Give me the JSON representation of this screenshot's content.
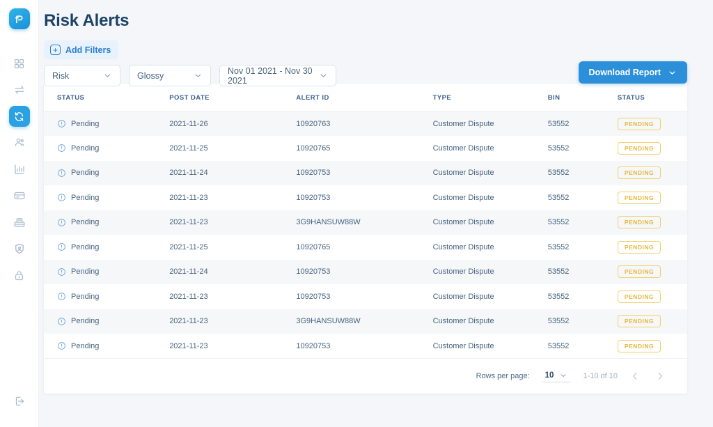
{
  "app": {
    "logo_name": "pagos-logo",
    "accent_blue": "#2b8fd9",
    "title_color": "#1c4266",
    "badge_color": "#e8b73c"
  },
  "sidebar": {
    "items": [
      {
        "icon": "grid-dashboard-icon",
        "active": false
      },
      {
        "icon": "transfer-arrows-icon",
        "active": false
      },
      {
        "icon": "refresh-sync-icon",
        "active": true
      },
      {
        "icon": "users-icon",
        "active": false
      },
      {
        "icon": "bar-chart-icon",
        "active": false
      },
      {
        "icon": "credit-card-icon",
        "active": false
      },
      {
        "icon": "cash-register-icon",
        "active": false
      },
      {
        "icon": "shield-user-icon",
        "active": false
      },
      {
        "icon": "lock-icon",
        "active": false
      }
    ],
    "logout": {
      "icon": "logout-icon"
    }
  },
  "header": {
    "title": "Risk Alerts"
  },
  "filters": {
    "add_filters_label": "Add Filters",
    "risk": {
      "value": "Risk"
    },
    "merchant": {
      "value": "Glossy"
    },
    "date_range": {
      "value": "Nov 01 2021 - Nov 30 2021"
    },
    "download_label": "Download Report"
  },
  "table": {
    "columns": [
      "STATUS",
      "POST DATE",
      "ALERT ID",
      "TYPE",
      "BIN",
      "STATUS"
    ],
    "rows": [
      {
        "status": "Pending",
        "post_date": "2021-11-26",
        "alert_id": "10920763",
        "type": "Customer Dispute",
        "bin": "53552",
        "badge": "PENDING"
      },
      {
        "status": "Pending",
        "post_date": "2021-11-25",
        "alert_id": "10920765",
        "type": "Customer Dispute",
        "bin": "53552",
        "badge": "PENDING"
      },
      {
        "status": "Pending",
        "post_date": "2021-11-24",
        "alert_id": "10920753",
        "type": "Customer Dispute",
        "bin": "53552",
        "badge": "PENDING"
      },
      {
        "status": "Pending",
        "post_date": "2021-11-23",
        "alert_id": "10920753",
        "type": "Customer Dispute",
        "bin": "53552",
        "badge": "PENDING"
      },
      {
        "status": "Pending",
        "post_date": "2021-11-23",
        "alert_id": "3G9HANSUW88W",
        "type": "Customer Dispute",
        "bin": "53552",
        "badge": "PENDING"
      },
      {
        "status": "Pending",
        "post_date": "2021-11-25",
        "alert_id": "10920765",
        "type": "Customer Dispute",
        "bin": "53552",
        "badge": "PENDING"
      },
      {
        "status": "Pending",
        "post_date": "2021-11-24",
        "alert_id": "10920753",
        "type": "Customer Dispute",
        "bin": "53552",
        "badge": "PENDING"
      },
      {
        "status": "Pending",
        "post_date": "2021-11-23",
        "alert_id": "10920753",
        "type": "Customer Dispute",
        "bin": "53552",
        "badge": "PENDING"
      },
      {
        "status": "Pending",
        "post_date": "2021-11-23",
        "alert_id": "3G9HANSUW88W",
        "type": "Customer Dispute",
        "bin": "53552",
        "badge": "PENDING"
      },
      {
        "status": "Pending",
        "post_date": "2021-11-23",
        "alert_id": "10920753",
        "type": "Customer Dispute",
        "bin": "53552",
        "badge": "PENDING"
      }
    ]
  },
  "pagination": {
    "rows_per_page_label": "Rows per page:",
    "rows_per_page_value": "10",
    "range_label": "1-10 of 10",
    "prev_icon": "chevron-left-icon",
    "next_icon": "chevron-right-icon"
  }
}
